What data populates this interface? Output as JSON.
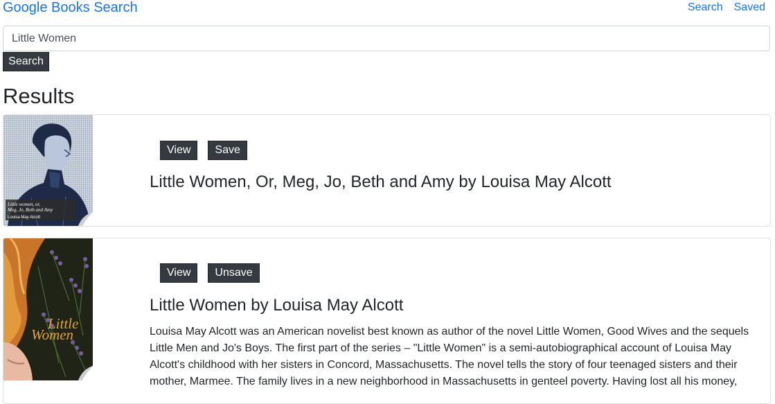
{
  "header": {
    "brand": "Google Books Search",
    "nav": [
      {
        "label": "Search"
      },
      {
        "label": "Saved"
      }
    ]
  },
  "search": {
    "value": "Little Women",
    "button_label": "Search"
  },
  "results": {
    "heading": "Results",
    "items": [
      {
        "title": "Little Women, Or, Meg, Jo, Beth and Amy by Louisa May Alcott",
        "view_label": "View",
        "save_label": "Save",
        "cover_text": [
          "Little women, or,",
          "Meg, Jo, Beth and Amy",
          "Louisa May Alcott"
        ],
        "description": ""
      },
      {
        "title": "Little Women by Louisa May Alcott",
        "view_label": "View",
        "save_label": "Unsave",
        "cover_text": [
          "Little",
          "Women"
        ],
        "description": "Louisa May Alcott was an American novelist best known as author of the novel Little Women, Good Wives and the sequels Little Men and Jo's Boys. The first part of the series – \"Little Women\" is a semi-autobiographical account of Louisa May Alcott's childhood with her sisters in Concord, Massachusetts. The novel tells the story of four teenaged sisters and their mother, Marmee. The family lives in a new neighborhood in Massachusetts in genteel poverty. Having lost all his money,"
      }
    ]
  },
  "colors": {
    "link": "#1a73e8",
    "button_bg": "#343a40",
    "text": "#212529"
  }
}
